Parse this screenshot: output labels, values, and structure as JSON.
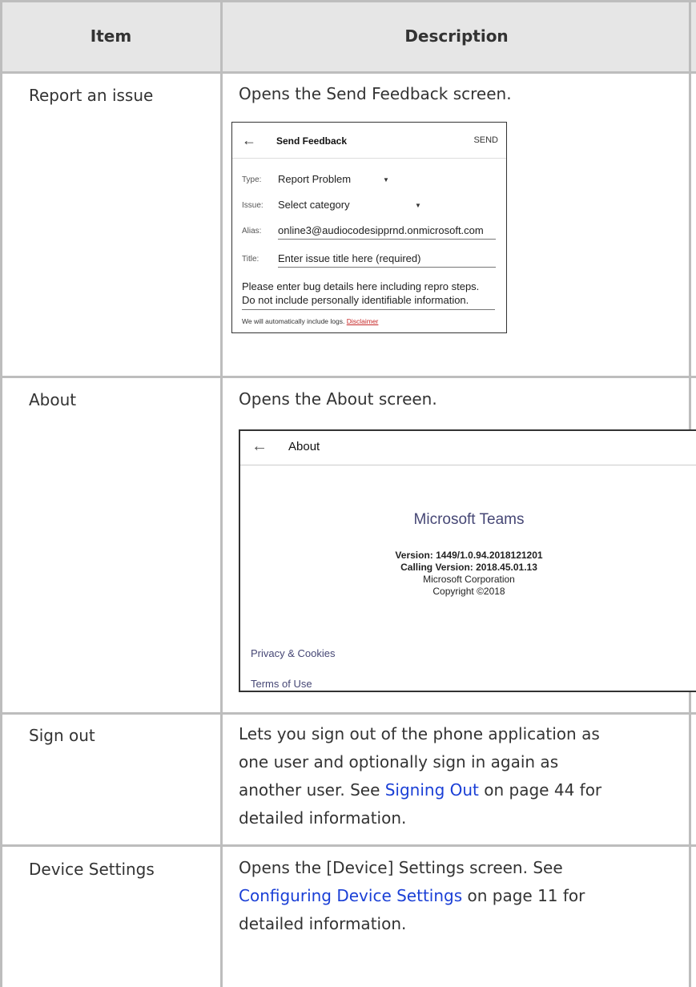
{
  "header": {
    "item": "Item",
    "description": "Description"
  },
  "rows": [
    {
      "item": "Report an issue",
      "description": "Opens the Send Feedback screen."
    },
    {
      "item": "About",
      "description": "Opens the About screen."
    },
    {
      "item": "Sign out",
      "description_lines": [
        "Lets you sign out of the phone application as",
        "one user and optionally sign in again as"
      ],
      "line3_pre": "another user. See ",
      "line3_link": "Signing Out",
      "line3_post": " on page 44 for",
      "line4": "detailed information."
    },
    {
      "item": "Device Settings",
      "line1": "Opens the [Device] Settings screen. See",
      "line2_link": "Configuring Device Settings",
      "line2_post": " on page 11 for",
      "line3": "detailed information."
    }
  ],
  "feedback": {
    "back_icon": "arrow-left-icon",
    "title": "Send Feedback",
    "send": "SEND",
    "type_label": "Type:",
    "type_value": "Report Problem",
    "issue_label": "Issue:",
    "issue_value": "Select category",
    "alias_label": "Alias:",
    "alias_value": "online3@audiocodesipprnd.onmicrosoft.com",
    "title_label": "Title:",
    "title_placeholder": "Enter issue title here (required)",
    "details_line1": "Please enter bug details here including repro steps.",
    "details_line2": "Do not include personally identifiable information.",
    "footer_text": "We will automatically include logs. ",
    "disclaimer": "Disclaimer"
  },
  "about": {
    "back_icon": "arrow-left-icon",
    "title": "About",
    "product": "Microsoft Teams",
    "version": "Version: 1449/1.0.94.2018121201",
    "calling_version": "Calling Version: 2018.45.01.13",
    "company": "Microsoft Corporation",
    "copyright": "Copyright ©2018",
    "privacy": "Privacy & Cookies",
    "terms": "Terms of Use"
  }
}
